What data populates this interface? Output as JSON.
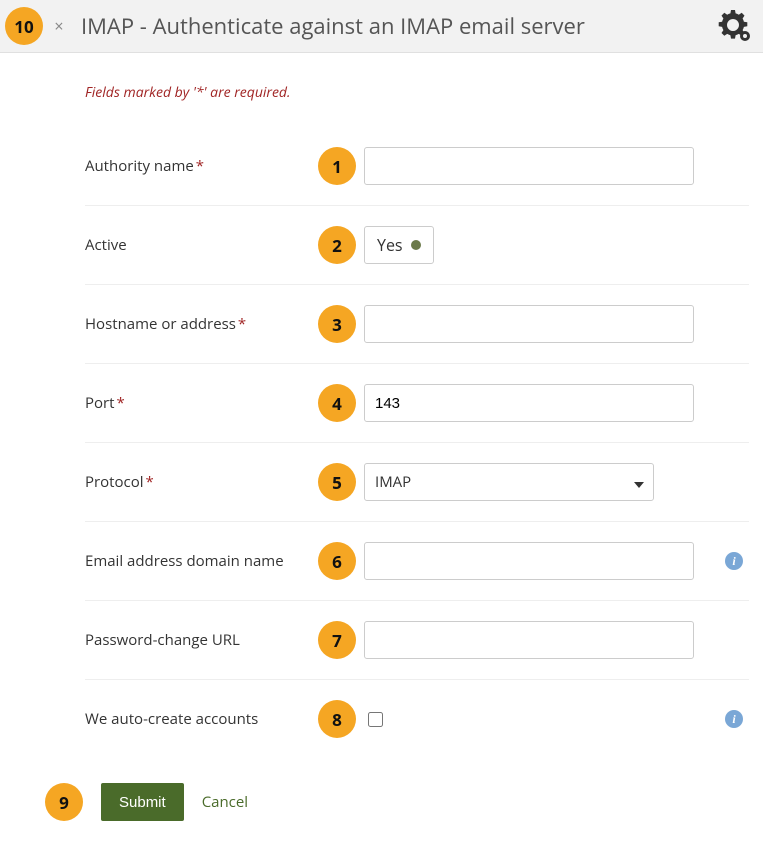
{
  "header": {
    "marker": "10",
    "close_glyph": "×",
    "title": "IMAP - Authenticate against an IMAP email server"
  },
  "required_note": "Fields marked by '*' are required.",
  "labels": {
    "authority_name": "Authority name",
    "active": "Active",
    "hostname": "Hostname or address",
    "port": "Port",
    "protocol": "Protocol",
    "email_domain": "Email address domain name",
    "pw_url": "Password-change URL",
    "auto_create": "We auto-create accounts"
  },
  "values": {
    "authority_name": "",
    "active": "Yes",
    "hostname": "",
    "port": "143",
    "protocol": "IMAP",
    "email_domain": "",
    "pw_url": "",
    "auto_create": false
  },
  "markers": {
    "authority_name": "1",
    "active": "2",
    "hostname": "3",
    "port": "4",
    "protocol": "5",
    "email_domain": "6",
    "pw_url": "7",
    "auto_create": "8",
    "actions": "9"
  },
  "actions": {
    "submit": "Submit",
    "cancel": "Cancel"
  },
  "info_glyph": "i",
  "asterisk": "*"
}
